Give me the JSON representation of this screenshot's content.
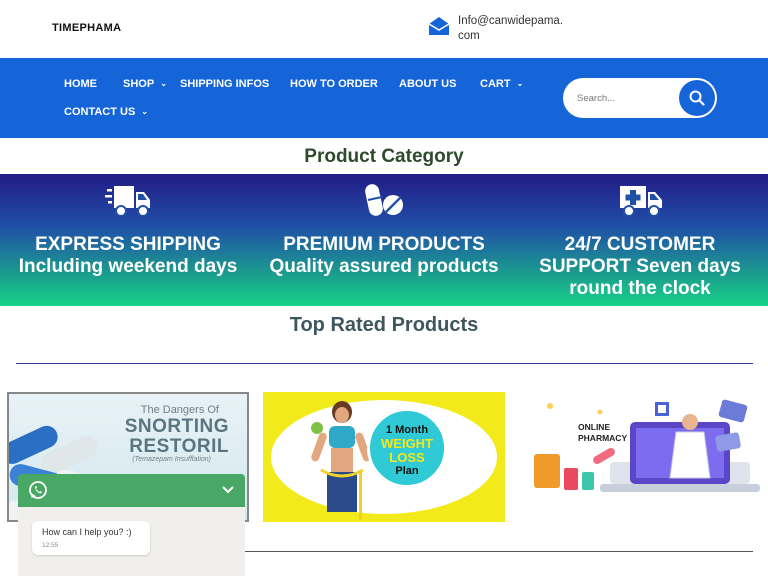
{
  "header": {
    "brand": "TIMEPHAMA",
    "email": "Info@canwidepama.com",
    "mail_icon": "envelope-icon"
  },
  "nav": {
    "items": [
      {
        "label": "HOME",
        "dropdown": false
      },
      {
        "label": "SHOP",
        "dropdown": true
      },
      {
        "label": "SHIPPING INFOS",
        "dropdown": false
      },
      {
        "label": "HOW TO ORDER",
        "dropdown": false
      },
      {
        "label": "ABOUT US",
        "dropdown": false
      },
      {
        "label": "CART",
        "dropdown": true
      },
      {
        "label": "CONTACT US",
        "dropdown": true
      }
    ],
    "search_placeholder": "Search...",
    "colors": {
      "nav_bg": "#1565d8",
      "accent": "#1565d8"
    }
  },
  "product_category": {
    "heading": "Product Category",
    "features": [
      {
        "icon": "delivery-truck-icon",
        "title": "EXPRESS SHIPPING",
        "subtitle": "Including weekend days"
      },
      {
        "icon": "pills-icon",
        "title": "PREMIUM PRODUCTS",
        "subtitle": "Quality assured products"
      },
      {
        "icon": "ambulance-icon",
        "title": "24/7 CUSTOMER",
        "subtitle": "SUPPORT Seven days round the clock"
      }
    ]
  },
  "top_rated": {
    "heading": "Top Rated Products",
    "products": [
      {
        "line1": "The Dangers Of",
        "line2": "SNORTING",
        "line3": "RESTORIL",
        "line4": "(Temazepam Insufflation)"
      },
      {
        "line1": "1 Month",
        "line2": "WEIGHT",
        "line3": "LOSS",
        "line4": "Plan"
      },
      {
        "line1": "ONLINE",
        "line2": "PHARMACY"
      }
    ]
  },
  "whatsapp": {
    "icon": "whatsapp-icon",
    "message": "How can I help you? :)",
    "time": "12:55",
    "color": "#4aa866"
  }
}
